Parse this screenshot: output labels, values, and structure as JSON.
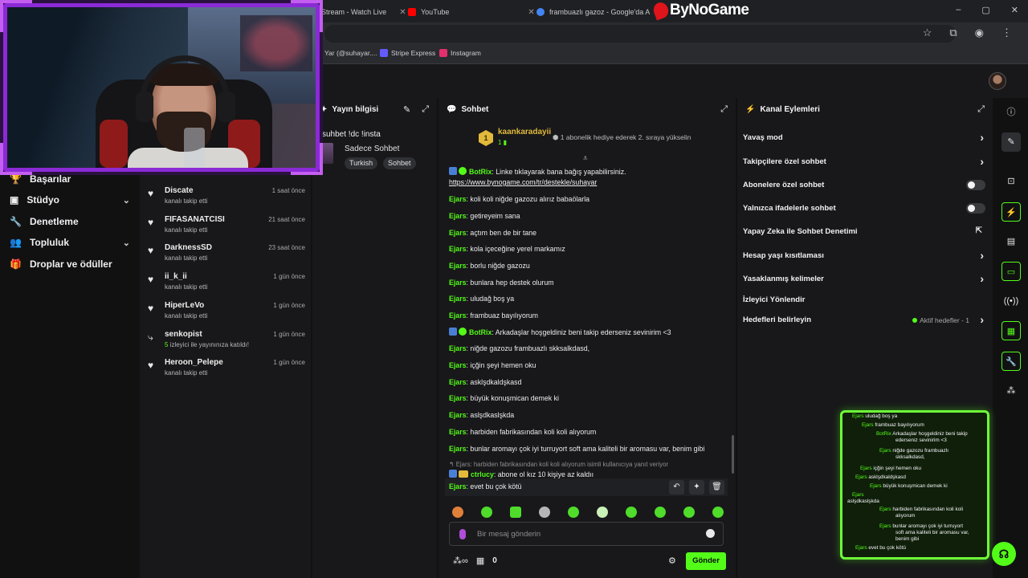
{
  "browser": {
    "tabs": [
      {
        "label": "Stream - Watch Live",
        "color": "#53fc18"
      },
      {
        "label": "YouTube",
        "color": "#ff0000"
      },
      {
        "label": "frambuazlı gazoz - Google'da A",
        "color": "#4285f4"
      }
    ],
    "brand": "ByNoGame",
    "window_controls": [
      "–",
      "▢",
      "✕"
    ],
    "bookmarks": [
      {
        "label": "Yar (@suhayar....",
        "color": "#888888"
      },
      {
        "label": "Stripe Express",
        "color": "#635bff"
      },
      {
        "label": "Instagram",
        "color": "#e1306c"
      }
    ]
  },
  "left_nav": {
    "items": [
      {
        "label": "Başarılar",
        "icon": "trophy-icon"
      },
      {
        "label": "Stüdyo",
        "icon": "camera-icon",
        "has_chevron": true
      },
      {
        "label": "Denetleme",
        "icon": "wrench-icon"
      },
      {
        "label": "Topluluk",
        "icon": "people-icon",
        "has_chevron": true
      },
      {
        "label": "Droplar ve ödüller",
        "icon": "gift-icon"
      }
    ]
  },
  "activity_feed": {
    "items": [
      {
        "name": "Discate",
        "time": "1 saat önce",
        "sub": "kanalı takip etti",
        "icon": "heart-icon"
      },
      {
        "name": "FIFASANATCISI",
        "time": "21 saat önce",
        "sub": "kanalı takip etti",
        "icon": "heart-icon"
      },
      {
        "name": "DarknessSD",
        "time": "23 saat önce",
        "sub": "kanalı takip etti",
        "icon": "heart-icon"
      },
      {
        "name": "ii_k_ii",
        "time": "1 gün önce",
        "sub": "kanalı takip etti",
        "icon": "heart-icon"
      },
      {
        "name": "HiperLeVo",
        "time": "1 gün önce",
        "sub": "kanalı takip etti",
        "icon": "heart-icon"
      },
      {
        "name": "senkopist",
        "time": "1 gün önce",
        "sub_highlight": "5",
        "sub": " izleyici ile yayınınıza katıldı!",
        "icon": "raid-icon"
      },
      {
        "name": "Heroon_Pelepe",
        "time": "1 gün önce",
        "sub": "kanalı takip etti",
        "icon": "heart-icon"
      }
    ]
  },
  "stream_info": {
    "header": "Yayın bilgisi",
    "title": "suhbet !dc !insta",
    "category": "Sadece Sohbet",
    "tags": [
      "Turkish",
      "Sohbet"
    ]
  },
  "chat": {
    "header": "Sohbet",
    "pinned": {
      "badge": "1",
      "user": "kaankaradayii",
      "count": "1",
      "info": "1 abonelik hediye ederek 2. sıraya yükselin"
    },
    "messages": [
      {
        "user": "BotRix",
        "bot": true,
        "text": "Linke tıklayarak bana bağış yapabilirsiniz.",
        "link": "https://www.bynogame.com/tr/destekle/suhayar"
      },
      {
        "user": "Ejars",
        "text": "koli koli niğde gazozu alırız babaölarla"
      },
      {
        "user": "Ejars",
        "text": "getireyeim sana"
      },
      {
        "user": "Ejars",
        "text": "açtım ben de bir tane"
      },
      {
        "user": "Ejars",
        "text": "kola içeceğine yerel markamız"
      },
      {
        "user": "Ejars",
        "text": "borlu niğde gazozu"
      },
      {
        "user": "Ejars",
        "text": "bunlara hep destek olurum"
      },
      {
        "user": "Ejars",
        "text": "uludağ boş ya"
      },
      {
        "user": "Ejars",
        "text": "frambuaz bayılıyorum"
      },
      {
        "user": "BotRix",
        "bot": true,
        "text": "Arkadaşlar hoşgeldiniz beni takip ederseniz sevinirim <3"
      },
      {
        "user": "Ejars",
        "text": "niğde gazozu frambuazlı skksalkdasd,"
      },
      {
        "user": "Ejars",
        "text": "içğin şeyi hemen oku"
      },
      {
        "user": "Ejars",
        "text": "asklşdkaldşkasd"
      },
      {
        "user": "Ejars",
        "text": "büyük konuşmican demek ki"
      },
      {
        "user": "Ejars",
        "text": "aslşdkaslşkda"
      },
      {
        "user": "Ejars",
        "text": "harbiden fabrikasından koli koli alıyorum"
      },
      {
        "user": "Ejars",
        "text": "bunlar aromayı çok iyi turruyort soft ama kaliteli bir aromasu var, benim gibi"
      },
      {
        "reply_ref": "Ejars: harbiden fabrikasından koli koli alıyorum isimli kullanıcıya yanıt veriyor"
      },
      {
        "user": "ctrlucy",
        "crown": true,
        "text": "abone ol kız 10 kişiye az kaldıı"
      },
      {
        "user": "Ejars",
        "text": "evet bu çok kötü"
      }
    ],
    "hover_actions": [
      "↶",
      "✦",
      "🗑"
    ],
    "input_placeholder": "Bir mesaj gönderin",
    "points_icon": "∞",
    "gift_count": "0",
    "send_label": "Gönder"
  },
  "channel_actions": {
    "header": "Kanal Eylemleri",
    "items": [
      {
        "label": "Yavaş mod",
        "control": "chevron"
      },
      {
        "label": "Takipçilere özel sohbet",
        "control": "chevron"
      },
      {
        "label": "Abonelere özel sohbet",
        "control": "toggle"
      },
      {
        "label": "Yalnızca ifadelerle sohbet",
        "control": "toggle"
      },
      {
        "label": "Yapay Zeka ile Sohbet Denetimi",
        "control": "external"
      },
      {
        "label": "Hesap yaşı kısıtlaması",
        "control": "chevron"
      },
      {
        "label": "Yasaklanmış kelimeler",
        "control": "chevron"
      },
      {
        "label": "İzleyici Yönlendir",
        "control": "none"
      },
      {
        "label": "Hedefleri belirleyin",
        "control": "chevron",
        "status": "Aktif hedefler - 1"
      }
    ]
  },
  "overlay_preview": {
    "lines": [
      {
        "u": "Ejars",
        "t": "uludağ boş ya"
      },
      {
        "u": "Ejars",
        "t": "frambuaz bayılıyorum"
      },
      {
        "u": "BotRix",
        "t": "Arkadaşlar hoşgeldiniz beni takip"
      },
      {
        "u": "",
        "t": "ederseniz sevinirim <3"
      },
      {
        "u": "Ejars",
        "t": "niğde gazozu frambuazlı"
      },
      {
        "u": "",
        "t": "skksalkdasd,"
      },
      {
        "u": "Ejars",
        "t": "içğin şeyi hemen oku"
      },
      {
        "u": "Ejars",
        "t": "asklşdkaldşkasd"
      },
      {
        "u": "Ejars",
        "t": "büyük konuşmican demek ki"
      },
      {
        "u": "Ejars",
        "t": ""
      },
      {
        "u": "",
        "t": "aslşdkaslşkda"
      },
      {
        "u": "Ejars",
        "t": "harbiden fabrikasından koli koli"
      },
      {
        "u": "",
        "t": "alıyorum"
      },
      {
        "u": "Ejars",
        "t": "bunlar aromayı çok iyi turruyort"
      },
      {
        "u": "",
        "t": "soft ama kaliteli bir aromasu var,"
      },
      {
        "u": "",
        "t": "benim gibi"
      },
      {
        "u": "Ejars",
        "t": "evet bu çok kötü"
      }
    ]
  },
  "colors": {
    "accent": "#53fc18",
    "cam_frame": "#8b2ad6",
    "gold": "#e2b93b"
  }
}
